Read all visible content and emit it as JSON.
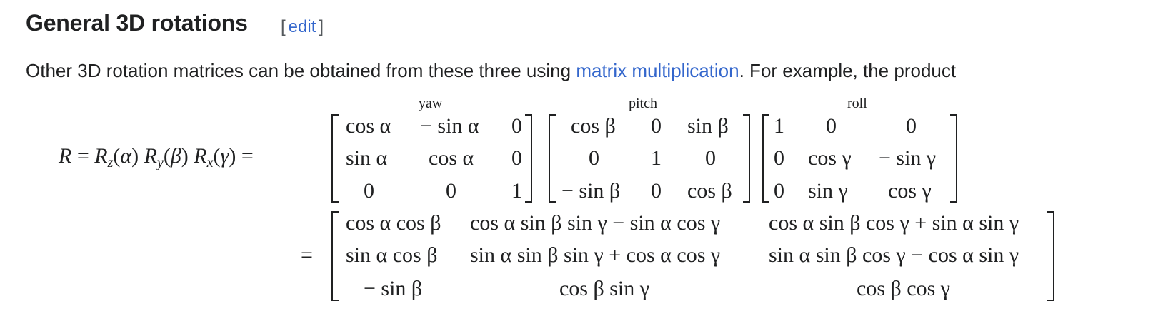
{
  "section": {
    "title": "General 3D rotations",
    "edit_open": "[",
    "edit_label": "edit",
    "edit_close": "]"
  },
  "paragraph": {
    "before_link": "Other 3D rotation matrices can be obtained from these three using ",
    "link_text": "matrix multiplication",
    "after_link": ". For example, the product"
  },
  "equation": {
    "lhs": "R = Rz(α) Ry(β) Rx(γ) =",
    "labels": {
      "yaw": "yaw",
      "pitch": "pitch",
      "roll": "roll"
    },
    "yaw_matrix": [
      [
        "cos α",
        "− sin α",
        "0"
      ],
      [
        "sin α",
        "cos α",
        "0"
      ],
      [
        "0",
        "0",
        "1"
      ]
    ],
    "pitch_matrix": [
      [
        "cos β",
        "0",
        "sin β"
      ],
      [
        "0",
        "1",
        "0"
      ],
      [
        "− sin β",
        "0",
        "cos β"
      ]
    ],
    "roll_matrix": [
      [
        "1",
        "0",
        "0"
      ],
      [
        "0",
        "cos γ",
        "− sin γ"
      ],
      [
        "0",
        "sin γ",
        "cos γ"
      ]
    ],
    "equals": "=",
    "result_matrix": [
      [
        "cos α cos β",
        "cos α sin β sin γ − sin α cos γ",
        "cos α sin β cos γ + sin α sin γ"
      ],
      [
        "sin α cos β",
        "sin α sin β sin γ + cos α cos γ",
        "sin α sin β cos γ − cos α sin γ"
      ],
      [
        "− sin β",
        "cos β sin γ",
        "cos β cos γ"
      ]
    ]
  }
}
